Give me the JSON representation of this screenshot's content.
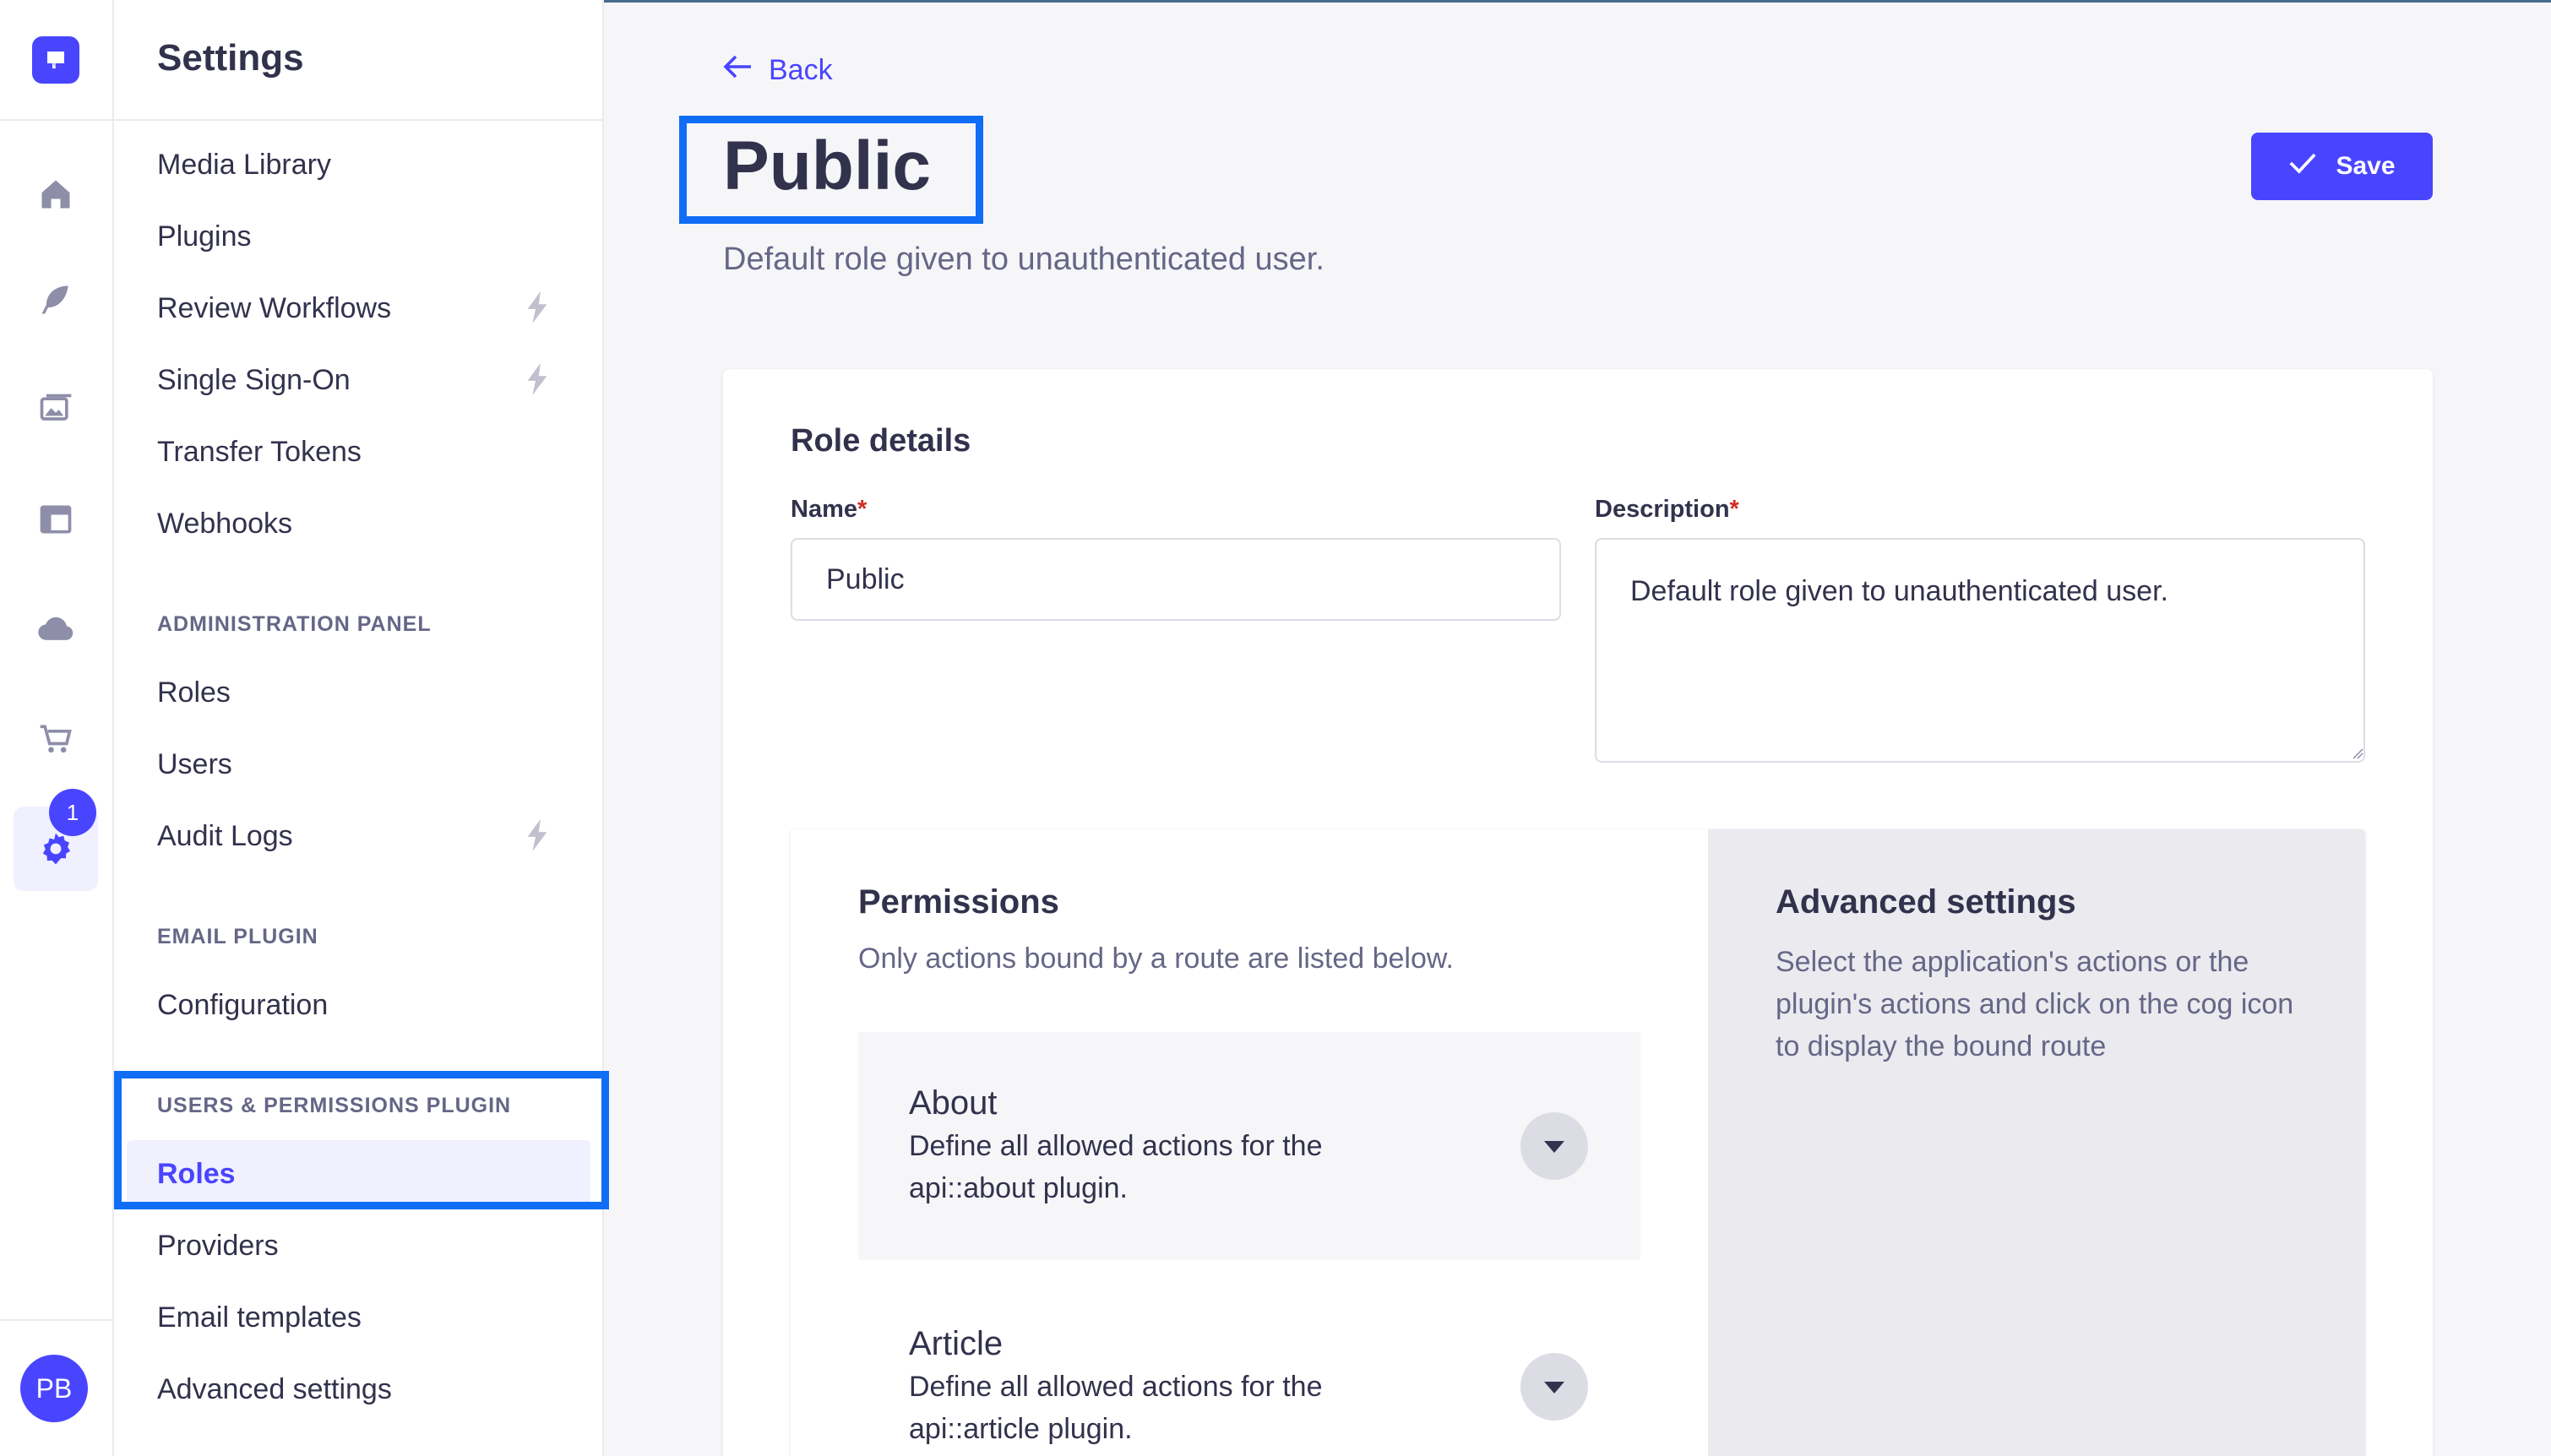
{
  "app": {
    "rail_icons": [
      "logo-icon",
      "home-icon",
      "feather-icon",
      "media-icon",
      "layout-icon",
      "cloud-icon",
      "cart-icon",
      "settings-cog-icon"
    ],
    "settings_badge": "1",
    "avatar_initials": "PB",
    "accent_color": "#4945ff"
  },
  "sidebar": {
    "title": "Settings",
    "top_items": [
      {
        "label": "Media Library"
      },
      {
        "label": "Plugins"
      },
      {
        "label": "Review Workflows",
        "icon": "lightning-icon"
      },
      {
        "label": "Single Sign-On",
        "icon": "lightning-icon"
      },
      {
        "label": "Transfer Tokens"
      },
      {
        "label": "Webhooks"
      }
    ],
    "admin_section": {
      "label": "ADMINISTRATION PANEL",
      "items": [
        {
          "label": "Roles"
        },
        {
          "label": "Users"
        },
        {
          "label": "Audit Logs",
          "icon": "lightning-icon"
        }
      ]
    },
    "email_section": {
      "label": "EMAIL PLUGIN",
      "items": [
        {
          "label": "Configuration"
        }
      ]
    },
    "users_section": {
      "label": "USERS & PERMISSIONS PLUGIN",
      "items": [
        {
          "label": "Roles",
          "active": true
        },
        {
          "label": "Providers"
        },
        {
          "label": "Email templates"
        },
        {
          "label": "Advanced settings"
        }
      ]
    }
  },
  "header": {
    "back_label": "Back",
    "title": "Public",
    "subtitle": "Default role given to unauthenticated user.",
    "save_label": "Save"
  },
  "role_details": {
    "heading": "Role details",
    "name_label": "Name",
    "name_value": "Public",
    "description_label": "Description",
    "description_value": "Default role given to unauthenticated user.",
    "required_mark": "*"
  },
  "permissions": {
    "title": "Permissions",
    "subtitle": "Only actions bound by a route are listed below.",
    "items": [
      {
        "title": "About",
        "description": "Define all allowed actions for the api::about plugin."
      },
      {
        "title": "Article",
        "description": "Define all allowed actions for the api::article plugin."
      }
    ]
  },
  "advanced": {
    "title": "Advanced settings",
    "text": "Select the application's actions or the plugin's actions and click on the cog icon to display the bound route"
  }
}
